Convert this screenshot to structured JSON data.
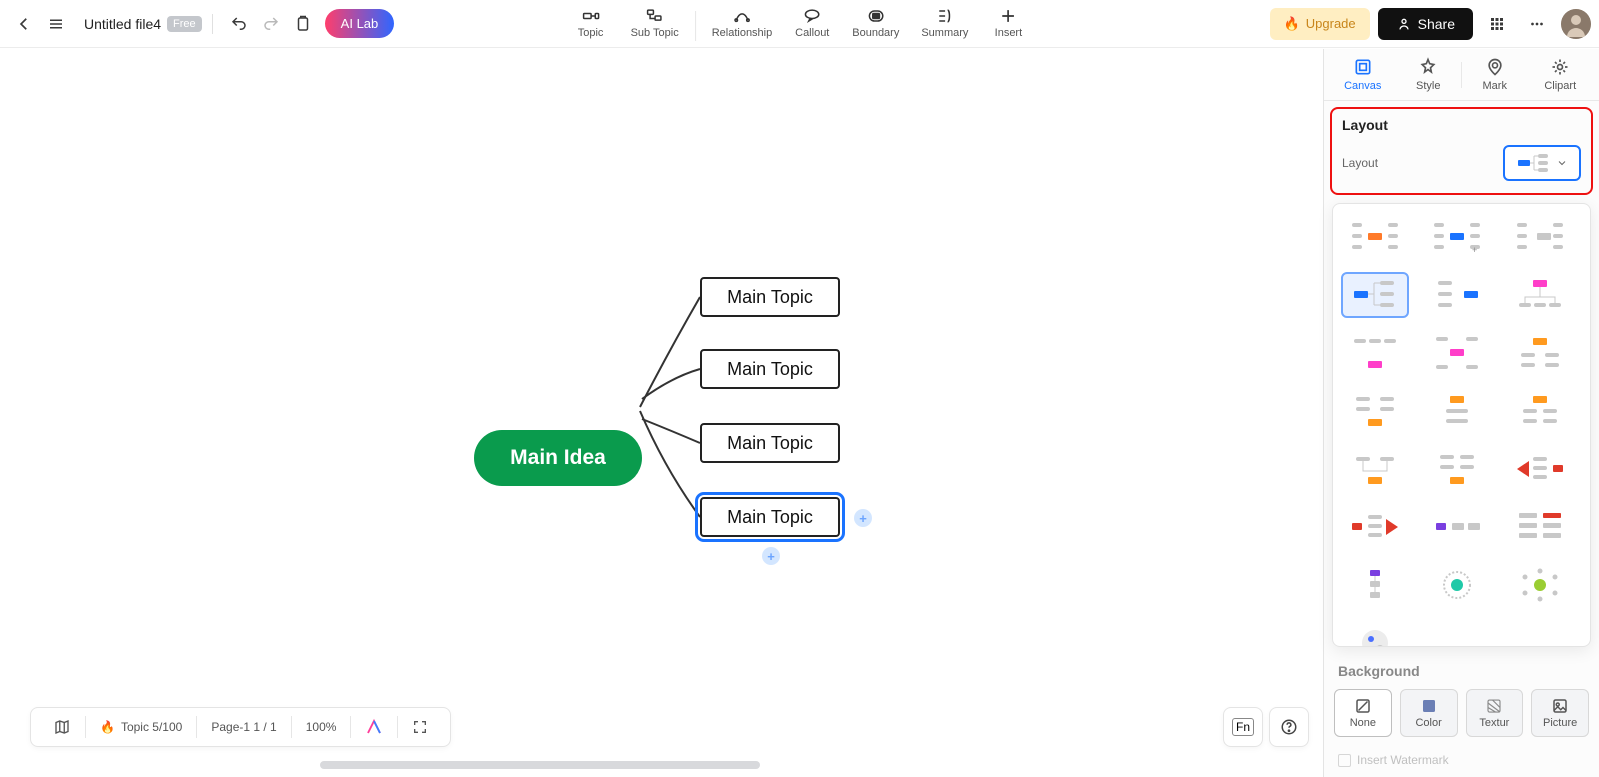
{
  "file": {
    "name": "Untitled file4",
    "badge": "Free"
  },
  "ai_lab": "AI Lab",
  "toolbar": {
    "topic": "Topic",
    "subtopic": "Sub Topic",
    "relationship": "Relationship",
    "callout": "Callout",
    "boundary": "Boundary",
    "summary": "Summary",
    "insert": "Insert"
  },
  "upgrade": "Upgrade",
  "share": "Share",
  "mindmap": {
    "root": "Main Idea",
    "topics": [
      "Main Topic",
      "Main Topic",
      "Main Topic",
      "Main Topic"
    ]
  },
  "panel": {
    "tabs": {
      "canvas": "Canvas",
      "style": "Style",
      "mark": "Mark",
      "clipart": "Clipart"
    },
    "layout_title": "Layout",
    "layout_label": "Layout",
    "background_title": "Background",
    "bg_tabs": {
      "none": "None",
      "color": "Color",
      "texture": "Textur",
      "picture": "Picture"
    },
    "watermark": "Insert Watermark"
  },
  "status": {
    "topic_count": "Topic 5/100",
    "page": "Page-1  1 / 1",
    "zoom": "100%"
  }
}
